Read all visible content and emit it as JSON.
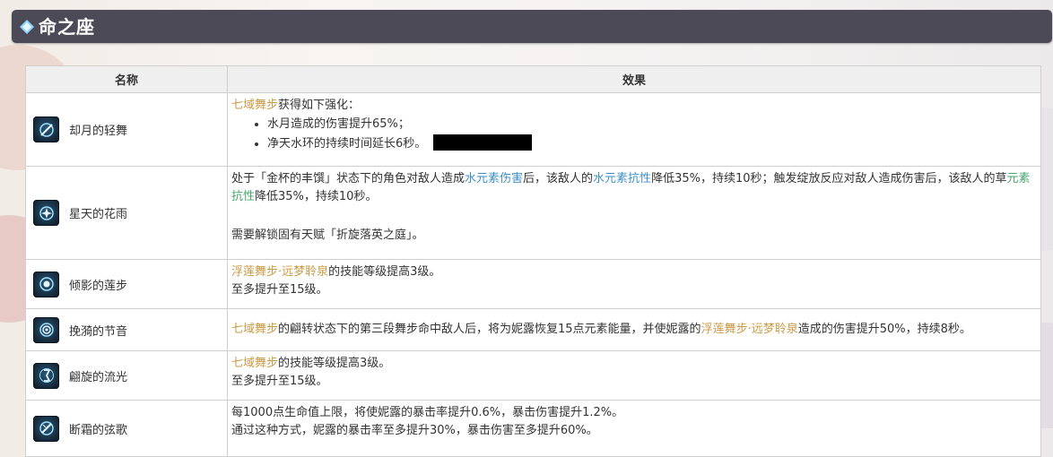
{
  "header": {
    "title": "命之座"
  },
  "table": {
    "col_name": "名称",
    "col_effect": "效果"
  },
  "rows": [
    {
      "name": "却月的轻舞",
      "icon": "moon-dance-icon",
      "intro_hl": "七域舞步",
      "intro_tail": "获得如下强化：",
      "bullet1": "水月造成的伤害提升65%；",
      "bullet2": "净天水环的持续时间延长6秒。"
    },
    {
      "name": "星天的花雨",
      "icon": "star-rain-icon",
      "p1": "处于「金杯的丰馔」状态下的角色对敌人造成",
      "p1_hl1": "水元素伤害",
      "p2": "后，该敌人的",
      "p2_hl": "水元素抗性",
      "p3": "降低35%，持续10秒；触发绽放反应对敌人造成伤害后，该敌人的草",
      "p3_hl": "元素抗性",
      "p4": "降低35%，持续10秒。",
      "note": "需要解锁固有天赋「折旋落英之庭」。"
    },
    {
      "name": "倾影的莲步",
      "icon": "lotus-step-icon",
      "hl": "浮莲舞步·远梦聆泉",
      "tail": "的技能等级提高3级。",
      "line2": "至多提升至15级。"
    },
    {
      "name": "挽漪的节音",
      "icon": "ripple-rhythm-icon",
      "hl1": "七域舞步",
      "t1": "的翩转状态下的第三段舞步命中敌人后，将为妮露恢复15点元素能量，并使妮露的",
      "hl2": "浮莲舞步·远梦聆泉",
      "t2": "造成的伤害提升50%，持续8秒。"
    },
    {
      "name": "翩旋的流光",
      "icon": "whirl-light-icon",
      "hl": "七域舞步",
      "tail": "的技能等级提高3级。",
      "line2": "至多提升至15级。"
    },
    {
      "name": "断霜的弦歌",
      "icon": "frost-string-icon",
      "line1": "每1000点生命值上限，将使妮露的暴击率提升0.6%，暴击伤害提升1.2%。",
      "line2": "通过这种方式，妮露的暴击率至多提升30%，暴击伤害至多提升60%。"
    }
  ],
  "colors": {
    "header_bg": "#4c4a57",
    "gold": "#c99a45",
    "blue": "#3f8fc8",
    "green": "#4aa56c"
  }
}
